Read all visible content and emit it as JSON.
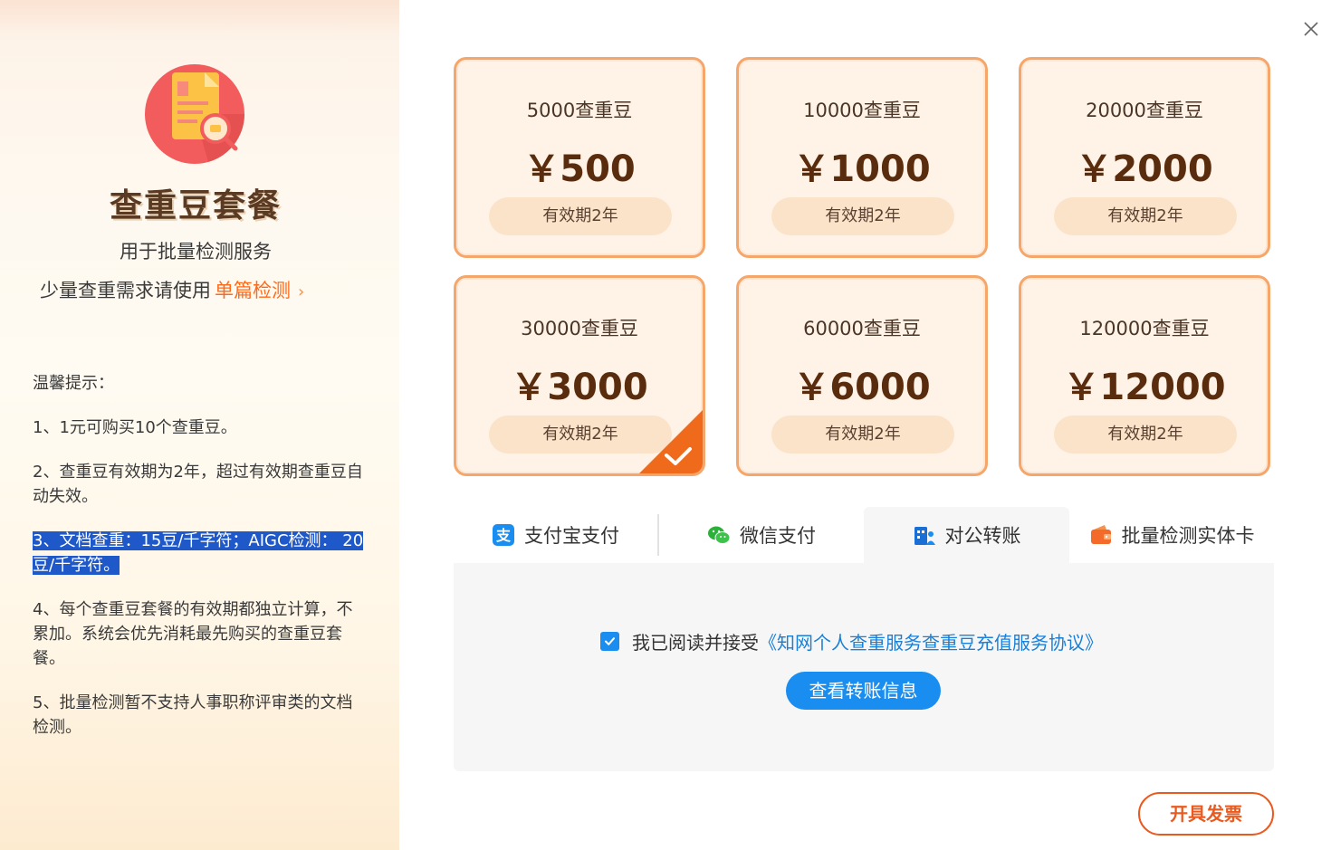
{
  "sidebar": {
    "title": "查重豆套餐",
    "subtitle": "用于批量检测服务",
    "hint_text": "少量查重需求请使用",
    "hint_link": "单篇检测",
    "hint_chevron": "›",
    "tips_heading": "温馨提示：",
    "tips": [
      "1、1元可购买10个查重豆。",
      "2、查重豆有效期为2年，超过有效期查重豆自动失效。",
      "3、文档查重：15豆/千字符；AIGC检测： 20豆/千字符。",
      "4、每个查重豆套餐的有效期都独立计算，不累加。系统会优先消耗最先购买的查重豆套餐。",
      "5、批量检测暂不支持人事职称评审类的文档检测。"
    ]
  },
  "packages": [
    {
      "beans": "5000查重豆",
      "price": "￥500",
      "validity": "有效期2年"
    },
    {
      "beans": "10000查重豆",
      "price": "￥1000",
      "validity": "有效期2年"
    },
    {
      "beans": "20000查重豆",
      "price": "￥2000",
      "validity": "有效期2年"
    },
    {
      "beans": "30000查重豆",
      "price": "￥3000",
      "validity": "有效期2年",
      "selected": true
    },
    {
      "beans": "60000查重豆",
      "price": "￥6000",
      "validity": "有效期2年"
    },
    {
      "beans": "120000查重豆",
      "price": "￥12000",
      "validity": "有效期2年"
    }
  ],
  "payment": {
    "tabs": [
      {
        "label": "支付宝支付",
        "icon": "alipay-icon"
      },
      {
        "label": "微信支付",
        "icon": "wechat-icon"
      },
      {
        "label": "对公转账",
        "icon": "bank-transfer-icon",
        "active": true
      },
      {
        "label": "批量检测实体卡",
        "icon": "wallet-card-icon"
      }
    ],
    "agree_text": "我已阅读并接受",
    "agreement_link": "《知网个人查重服务查重豆充值服务协议》",
    "view_button": "查看转账信息",
    "agree_checked": true
  },
  "invoice_button": "开具发票",
  "colors": {
    "accent_orange": "#ff6a1a",
    "card_border": "#f4a66b",
    "primary_blue": "#1a8ef0",
    "selection_blue": "#1f58c9"
  }
}
